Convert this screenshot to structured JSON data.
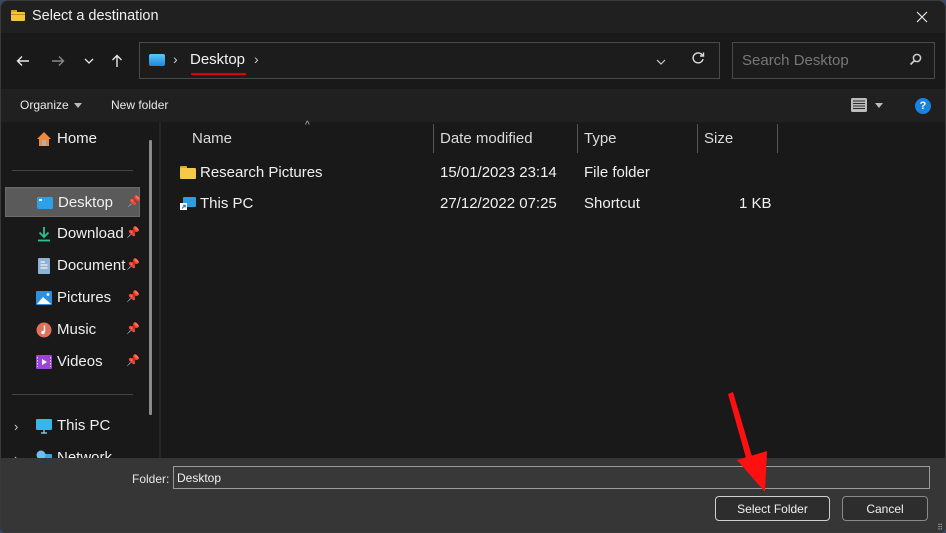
{
  "window": {
    "title": "Select a destination",
    "close_icon": "close-icon"
  },
  "navigation": {
    "back_icon": "arrow-left-icon",
    "forward_icon": "arrow-right-icon",
    "recent_icon": "chevron-down-icon",
    "up_icon": "arrow-up-icon"
  },
  "address_bar": {
    "location_icon": "desktop-icon",
    "breadcrumbs": [
      "Desktop"
    ],
    "separator": "›",
    "highlight_color": "#e00000",
    "dropdown_icon": "chevron-down-icon",
    "refresh_icon": "refresh-icon"
  },
  "search": {
    "placeholder": "Search Desktop",
    "value": "",
    "icon": "search-icon"
  },
  "toolbar": {
    "organize_label": "Organize",
    "new_folder_label": "New folder",
    "view_icon": "details-view-icon",
    "help_label": "?"
  },
  "sidebar": {
    "items": [
      {
        "label": "Home",
        "icon": "home-icon",
        "pinned": false,
        "selected": false
      },
      {
        "label": "Desktop",
        "icon": "desktop-icon",
        "pinned": true,
        "selected": true
      },
      {
        "label": "Download",
        "icon": "download-icon",
        "pinned": true,
        "selected": false
      },
      {
        "label": "Document",
        "icon": "document-icon",
        "pinned": true,
        "selected": false
      },
      {
        "label": "Pictures",
        "icon": "pictures-icon",
        "pinned": true,
        "selected": false
      },
      {
        "label": "Music",
        "icon": "music-icon",
        "pinned": true,
        "selected": false
      },
      {
        "label": "Videos",
        "icon": "videos-icon",
        "pinned": true,
        "selected": false
      }
    ],
    "tree": [
      {
        "label": "This PC",
        "icon": "this-pc-icon",
        "expandable": true
      },
      {
        "label": "Network",
        "icon": "network-icon",
        "expandable": true
      }
    ],
    "pin_glyph": "📌"
  },
  "file_list": {
    "columns": [
      "Name",
      "Date modified",
      "Type",
      "Size"
    ],
    "sort_column": "Name",
    "rows": [
      {
        "name": "Research Pictures",
        "icon": "folder-icon",
        "date": "15/01/2023 23:14",
        "type": "File folder",
        "size": ""
      },
      {
        "name": "This PC",
        "icon": "shortcut-pc-icon",
        "date": "27/12/2022 07:25",
        "type": "Shortcut",
        "size": "1 KB"
      }
    ]
  },
  "footer": {
    "folder_label": "Folder:",
    "folder_value": "Desktop",
    "select_button": "Select Folder",
    "cancel_button": "Cancel"
  },
  "annotation": {
    "arrow_color": "#ff1010",
    "points_to": "Select Folder"
  }
}
